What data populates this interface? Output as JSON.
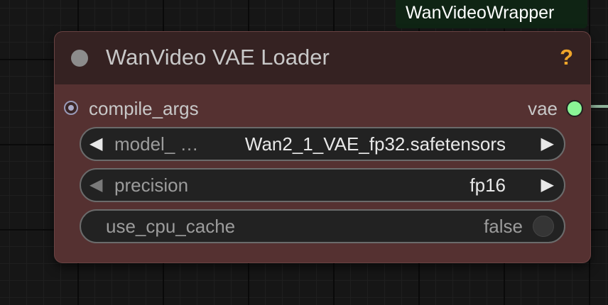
{
  "group": {
    "label": "WanVideoWrapper"
  },
  "node": {
    "title": "WanVideo VAE Loader",
    "help_glyph": "?",
    "inputs": [
      {
        "label": "compile_args"
      }
    ],
    "outputs": [
      {
        "label": "vae",
        "color": "#8af596"
      }
    ],
    "widgets": [
      {
        "label": "model_ …",
        "value": "Wan2_1_VAE_fp32.safetensors",
        "type": "combo"
      },
      {
        "label": "precision",
        "value": "fp16",
        "type": "combo"
      },
      {
        "label": "use_cpu_cache",
        "value": "false",
        "type": "toggle"
      }
    ]
  },
  "icons": {
    "left_arrow": "◀",
    "right_arrow": "▶"
  },
  "colors": {
    "node_body": "#553131",
    "node_title": "#352222",
    "group_header": "#0f2414",
    "help": "#f0a62a"
  }
}
